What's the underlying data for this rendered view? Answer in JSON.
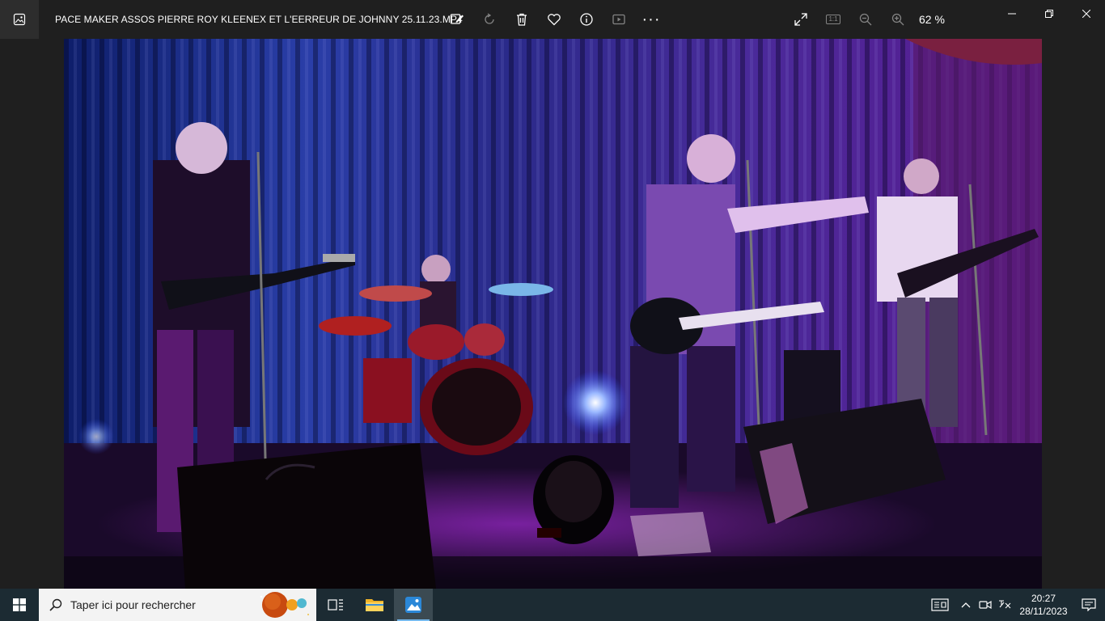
{
  "window": {
    "title": "PACE MAKER ASSOS PIERRE ROY KLEENEX ET L'EERREUR DE JOHNNY 25.11.23.MP4",
    "app_icon": "photos-app-icon"
  },
  "toolbar": {
    "items": [
      "edit-icon",
      "rotate-icon",
      "delete-icon",
      "favorite-icon",
      "info-icon",
      "slideshow-icon",
      "more-icon"
    ],
    "more_label": "···"
  },
  "view_tools": {
    "items": [
      "fullscreen-icon",
      "actual-size-icon",
      "zoom-out-icon",
      "zoom-in-icon"
    ],
    "actual_size_label": "1:1",
    "zoom_level": "62 %"
  },
  "window_controls": [
    "minimize-icon",
    "restore-icon",
    "close-icon"
  ],
  "taskbar": {
    "search_placeholder": "Taper ici pour rechercher",
    "apps": [
      "task-view-icon",
      "file-explorer-icon",
      "photos-icon"
    ],
    "tray": [
      "news-icon",
      "chevron-up-icon",
      "meet-icon",
      "keyboard-icon"
    ],
    "time": "20:27",
    "date": "28/11/2023"
  },
  "colors": {
    "titlebar_bg": "#1f1f1f",
    "taskbar_bg": "#1c2b33",
    "accent": "#76b9ed",
    "stage_purple": "#6a2cc0"
  }
}
